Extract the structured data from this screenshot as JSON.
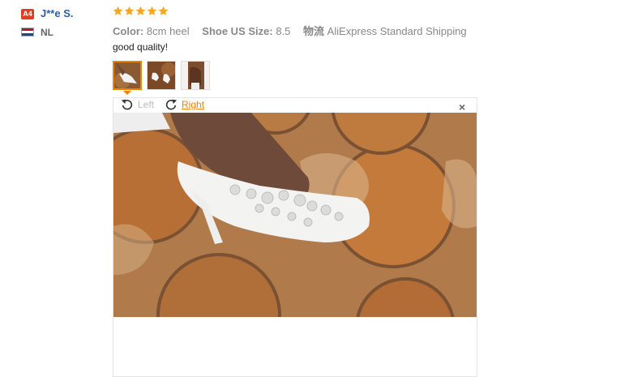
{
  "reviewer": {
    "level_badge": "A4",
    "name": "J**e S.",
    "country_code": "NL"
  },
  "rating": {
    "stars": 5,
    "max": 5,
    "color": "#f5a623"
  },
  "order_info": {
    "color_label": "Color:",
    "color_value": "8cm heel",
    "size_label": "Shoe US Size:",
    "size_value": "8.5",
    "shipping_label": "物流",
    "shipping_value": "AliExpress Standard Shipping"
  },
  "review_text": "good quality!",
  "thumbnails": [
    {
      "icon": "shoe-photo-1",
      "selected": true
    },
    {
      "icon": "shoe-photo-2",
      "selected": false
    },
    {
      "icon": "shoe-photo-3",
      "selected": false
    }
  ],
  "viewer": {
    "rotate_left_label": "Left",
    "rotate_right_label": "Right",
    "close_icon": "×",
    "accent_color": "#f08200"
  }
}
